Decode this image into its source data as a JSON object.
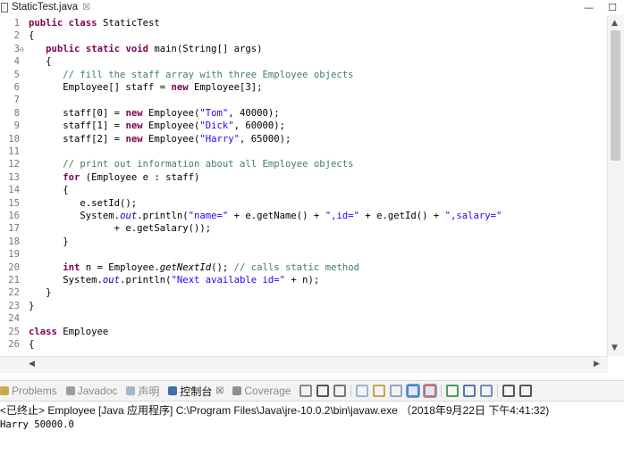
{
  "editor": {
    "tab_label": "StaticTest.java",
    "lines": [
      {
        "n": "1",
        "fold": "",
        "tokens": [
          {
            "t": "kw",
            "v": "public"
          },
          {
            "t": "",
            "v": " "
          },
          {
            "t": "kw",
            "v": "class"
          },
          {
            "t": "",
            "v": " StaticTest"
          }
        ]
      },
      {
        "n": "2",
        "fold": "",
        "tokens": [
          {
            "t": "",
            "v": "{"
          }
        ]
      },
      {
        "n": "3",
        "fold": "⊖",
        "tokens": [
          {
            "t": "",
            "v": "   "
          },
          {
            "t": "kw",
            "v": "public"
          },
          {
            "t": "",
            "v": " "
          },
          {
            "t": "kw",
            "v": "static"
          },
          {
            "t": "",
            "v": " "
          },
          {
            "t": "kw",
            "v": "void"
          },
          {
            "t": "",
            "v": " main(String[] args)"
          }
        ]
      },
      {
        "n": "4",
        "fold": "",
        "tokens": [
          {
            "t": "",
            "v": "   {"
          }
        ]
      },
      {
        "n": "5",
        "fold": "",
        "tokens": [
          {
            "t": "",
            "v": "      "
          },
          {
            "t": "cm",
            "v": "// fill the staff array with three Employee objects"
          }
        ]
      },
      {
        "n": "6",
        "fold": "",
        "tokens": [
          {
            "t": "",
            "v": "      Employee[] staff = "
          },
          {
            "t": "kw",
            "v": "new"
          },
          {
            "t": "",
            "v": " Employee[3];"
          }
        ]
      },
      {
        "n": "7",
        "fold": "",
        "tokens": []
      },
      {
        "n": "8",
        "fold": "",
        "tokens": [
          {
            "t": "",
            "v": "      staff[0] = "
          },
          {
            "t": "kw",
            "v": "new"
          },
          {
            "t": "",
            "v": " Employee("
          },
          {
            "t": "str",
            "v": "\"Tom\""
          },
          {
            "t": "",
            "v": ", 40000);"
          }
        ]
      },
      {
        "n": "9",
        "fold": "",
        "tokens": [
          {
            "t": "",
            "v": "      staff[1] = "
          },
          {
            "t": "kw",
            "v": "new"
          },
          {
            "t": "",
            "v": " Employee("
          },
          {
            "t": "str",
            "v": "\"Dick\""
          },
          {
            "t": "",
            "v": ", 60000);"
          }
        ]
      },
      {
        "n": "10",
        "fold": "",
        "tokens": [
          {
            "t": "",
            "v": "      staff[2] = "
          },
          {
            "t": "kw",
            "v": "new"
          },
          {
            "t": "",
            "v": " Employee("
          },
          {
            "t": "str",
            "v": "\"Harry\""
          },
          {
            "t": "",
            "v": ", 65000);"
          }
        ]
      },
      {
        "n": "11",
        "fold": "",
        "tokens": []
      },
      {
        "n": "12",
        "fold": "",
        "tokens": [
          {
            "t": "",
            "v": "      "
          },
          {
            "t": "cm",
            "v": "// print out information about all Employee objects"
          }
        ]
      },
      {
        "n": "13",
        "fold": "",
        "tokens": [
          {
            "t": "",
            "v": "      "
          },
          {
            "t": "kw",
            "v": "for"
          },
          {
            "t": "",
            "v": " (Employee e : staff)"
          }
        ]
      },
      {
        "n": "14",
        "fold": "",
        "tokens": [
          {
            "t": "",
            "v": "      {"
          }
        ]
      },
      {
        "n": "15",
        "fold": "",
        "tokens": [
          {
            "t": "",
            "v": "         e.setId();"
          }
        ]
      },
      {
        "n": "16",
        "fold": "",
        "tokens": [
          {
            "t": "",
            "v": "         System."
          },
          {
            "t": "fld",
            "v": "out"
          },
          {
            "t": "",
            "v": ".println("
          },
          {
            "t": "str",
            "v": "\"name=\""
          },
          {
            "t": "",
            "v": " + e.getName() + "
          },
          {
            "t": "str",
            "v": "\",id=\""
          },
          {
            "t": "",
            "v": " + e.getId() + "
          },
          {
            "t": "str",
            "v": "\",salary=\""
          }
        ]
      },
      {
        "n": "17",
        "fold": "",
        "tokens": [
          {
            "t": "",
            "v": "               + e.getSalary());"
          }
        ]
      },
      {
        "n": "18",
        "fold": "",
        "tokens": [
          {
            "t": "",
            "v": "      }"
          }
        ]
      },
      {
        "n": "19",
        "fold": "",
        "tokens": []
      },
      {
        "n": "20",
        "fold": "",
        "tokens": [
          {
            "t": "",
            "v": "      "
          },
          {
            "t": "kw",
            "v": "int"
          },
          {
            "t": "",
            "v": " n = Employee."
          },
          {
            "t": "smeth",
            "v": "getNextId"
          },
          {
            "t": "",
            "v": "(); "
          },
          {
            "t": "cm",
            "v": "// calls static method"
          }
        ]
      },
      {
        "n": "21",
        "fold": "",
        "tokens": [
          {
            "t": "",
            "v": "      System."
          },
          {
            "t": "fld",
            "v": "out"
          },
          {
            "t": "",
            "v": ".println("
          },
          {
            "t": "str",
            "v": "\"Next available id=\""
          },
          {
            "t": "",
            "v": " + n);"
          }
        ]
      },
      {
        "n": "22",
        "fold": "",
        "tokens": [
          {
            "t": "",
            "v": "   }"
          }
        ]
      },
      {
        "n": "23",
        "fold": "",
        "tokens": [
          {
            "t": "",
            "v": "}"
          }
        ]
      },
      {
        "n": "24",
        "fold": "",
        "tokens": []
      },
      {
        "n": "25",
        "fold": "",
        "tokens": [
          {
            "t": "kw",
            "v": "class"
          },
          {
            "t": "",
            "v": " Employee"
          }
        ]
      },
      {
        "n": "26",
        "fold": "",
        "tokens": [
          {
            "t": "",
            "v": "{"
          }
        ]
      }
    ]
  },
  "panel": {
    "tabs": [
      {
        "label": "Problems",
        "icon": "problems-icon",
        "color": "#c9a94c",
        "active": false
      },
      {
        "label": "Javadoc",
        "icon": "javadoc-icon",
        "color": "#9c9c9c",
        "active": false
      },
      {
        "label": "声明",
        "icon": "declaration-icon",
        "color": "#9fb6cf",
        "active": false
      },
      {
        "label": "控制台",
        "icon": "console-icon",
        "color": "#3f6fa6",
        "active": true
      },
      {
        "label": "Coverage",
        "icon": "coverage-icon",
        "color": "#8f8f8f",
        "active": false
      }
    ],
    "toolbar_icons": [
      {
        "name": "terminate-icon",
        "color": "#8a8a8a"
      },
      {
        "name": "remove-launch-icon",
        "color": "#555555"
      },
      {
        "name": "remove-all-terminated-icon",
        "color": "#777777"
      },
      {
        "name": "clear-console-icon",
        "color": "#9db5d3"
      },
      {
        "name": "scroll-lock-icon",
        "color": "#c8a35a"
      },
      {
        "name": "word-wrap-icon",
        "color": "#8fa7c6"
      },
      {
        "name": "show-on-output-icon",
        "color": "#4f86c6"
      },
      {
        "name": "show-on-error-icon",
        "color": "#d46a6a"
      },
      {
        "name": "pin-console-icon",
        "color": "#4f9a5a"
      },
      {
        "name": "display-console-icon",
        "color": "#5576a8"
      },
      {
        "name": "open-console-icon",
        "color": "#6e8fbf"
      },
      {
        "name": "minimize-icon",
        "color": "#555555"
      },
      {
        "name": "maximize-icon",
        "color": "#555555"
      }
    ],
    "console_status": "<已终止> Employee [Java 应用程序] C:\\Program Files\\Java\\jre-10.0.2\\bin\\javaw.exe （2018年9月22日 下午4:41:32)",
    "console_output": "Harry 50000.0"
  }
}
